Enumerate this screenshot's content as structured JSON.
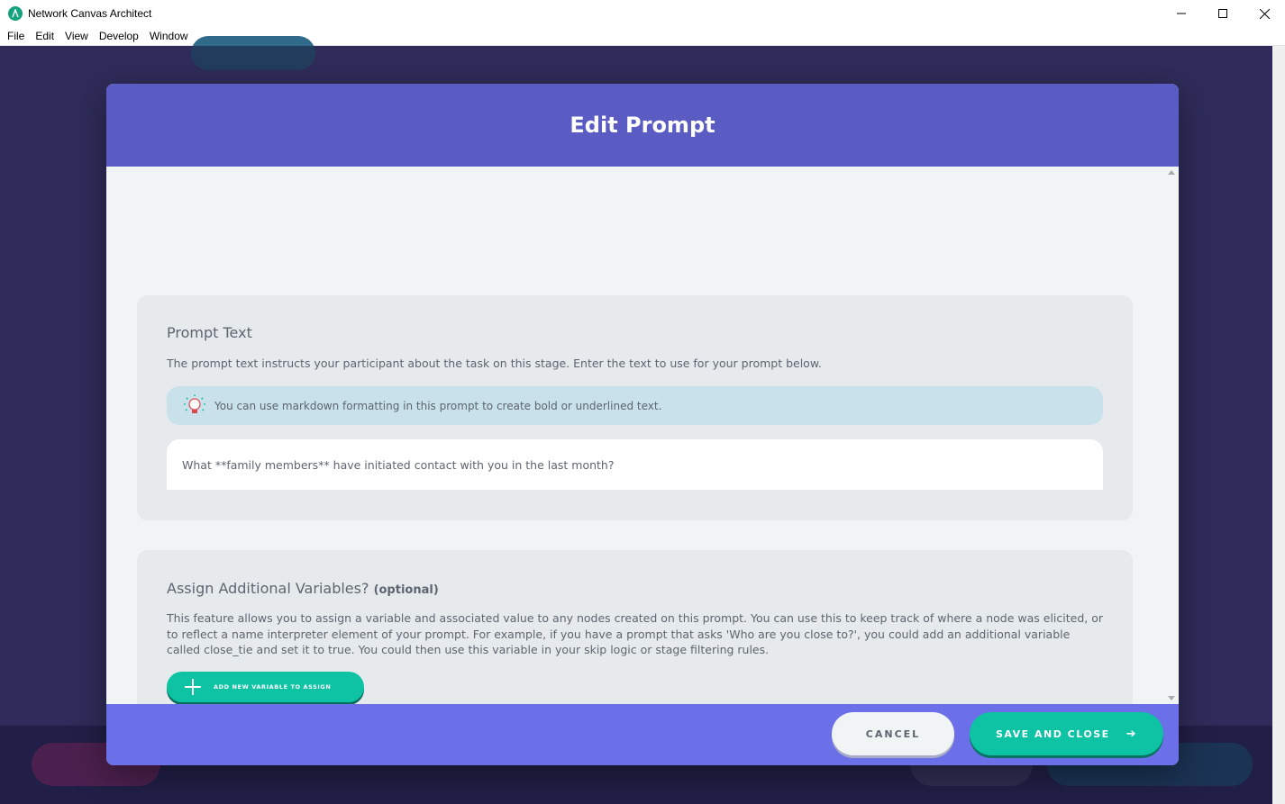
{
  "window": {
    "title": "Network Canvas Architect",
    "icon": "network-canvas-logo-icon",
    "controls": [
      "minimize-icon",
      "maximize-icon",
      "close-icon"
    ]
  },
  "menu": {
    "items": [
      {
        "label": "File"
      },
      {
        "label": "Edit"
      },
      {
        "label": "View"
      },
      {
        "label": "Develop"
      },
      {
        "label": "Window"
      }
    ]
  },
  "modal": {
    "title": "Edit Prompt",
    "prompt_section": {
      "heading": "Prompt Text",
      "description": "The prompt text instructs your participant about the task on this stage. Enter the text to use for your prompt below.",
      "tip": "You can use markdown formatting in this prompt to create bold or underlined text.",
      "tip_icon": "lightbulb-icon",
      "input_value": "What **family members** have initiated contact with you in the last month?"
    },
    "variables_section": {
      "heading": "Assign Additional Variables?",
      "heading_suffix": "(optional)",
      "description": "This feature allows you to assign a variable and associated value to any nodes created on this prompt. You can use this to keep track of where a node was elicited, or to reflect a name interpreter element of your prompt. For example, if you have a prompt that asks 'Who are you close to?', you could add an additional variable called close_tie and set it to true. You could then use this variable in your skip logic or stage filtering rules.",
      "add_button_label": "ADD NEW VARIABLE TO ASSIGN"
    },
    "footer": {
      "cancel_label": "CANCEL",
      "save_label": "SAVE AND CLOSE",
      "save_icon": "arrow-right-icon"
    }
  },
  "colors": {
    "modal_header": "#5a5bc3",
    "modal_footer": "#6b70e8",
    "accent_green": "#0ec2a4",
    "section_bg": "#e6eaed",
    "tip_bg": "#c8e1ea",
    "body_bg": "#f1f4f5"
  }
}
